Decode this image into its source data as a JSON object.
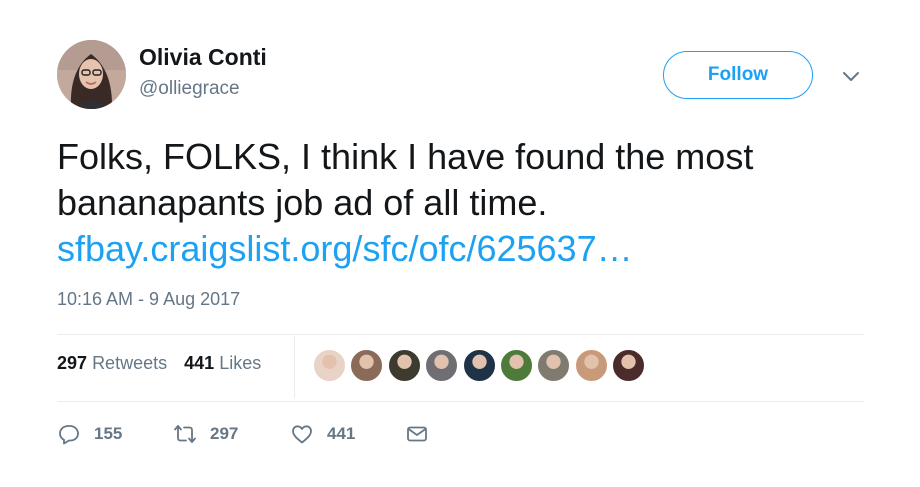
{
  "author": {
    "name": "Olivia Conti",
    "handle": "@olliegrace"
  },
  "follow_label": "Follow",
  "tweet": {
    "line1": "Folks, FOLKS, I think I have found the most",
    "line2": "bananapants job ad of all time.",
    "link": "sfbay.craigslist.org/sfc/ofc/625637…"
  },
  "timestamp": "10:16 AM - 9 Aug 2017",
  "stats": {
    "retweets_count": "297",
    "retweets_label": "Retweets",
    "likes_count": "441",
    "likes_label": "Likes"
  },
  "liker_avatars": [
    "#e9d3c6",
    "#8a6a58",
    "#3d3a2f",
    "#6f6f73",
    "#1e3347",
    "#4e7a3a",
    "#7f7b70",
    "#c99a7a",
    "#4b2b2b"
  ],
  "actions": {
    "replies": "155",
    "retweets": "297",
    "likes": "441"
  },
  "colors": {
    "accent": "#1da1f2",
    "secondary_text": "#657786",
    "primary_text": "#14171a",
    "divider": "#e6ecf0"
  }
}
